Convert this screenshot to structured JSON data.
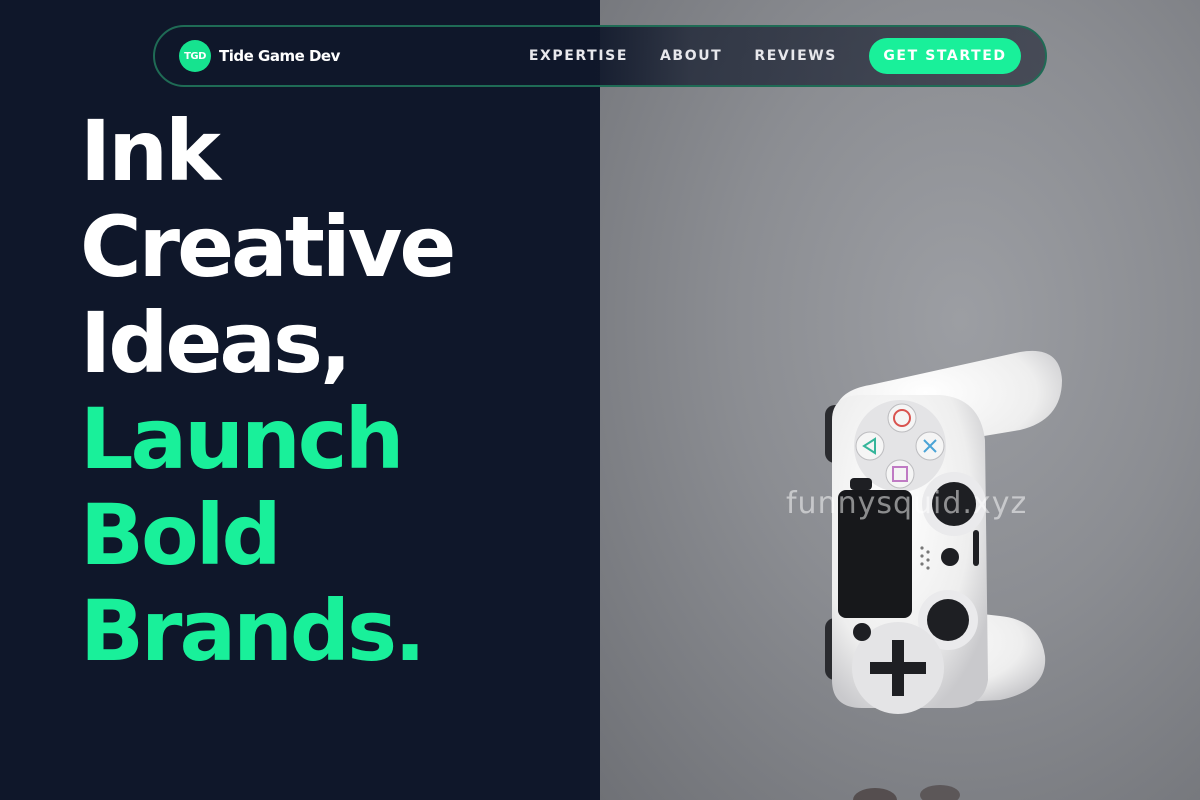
{
  "navbar": {
    "logo_badge": "TGD",
    "brand_name": "Tide Game Dev",
    "links": [
      {
        "label": "EXPERTISE"
      },
      {
        "label": "ABOUT"
      },
      {
        "label": "REVIEWS"
      }
    ],
    "cta_label": "GET STARTED"
  },
  "hero": {
    "headline_white": [
      "Ink",
      "Creative",
      "Ideas,"
    ],
    "headline_green": [
      "Launch",
      "Bold",
      "Brands."
    ],
    "image_alt": "white game controller floating against grey background",
    "watermark": "funnysquid.xyz"
  },
  "colors": {
    "background": "#0f172a",
    "accent": "#19f09a",
    "nav_border": "#1f6b55"
  }
}
